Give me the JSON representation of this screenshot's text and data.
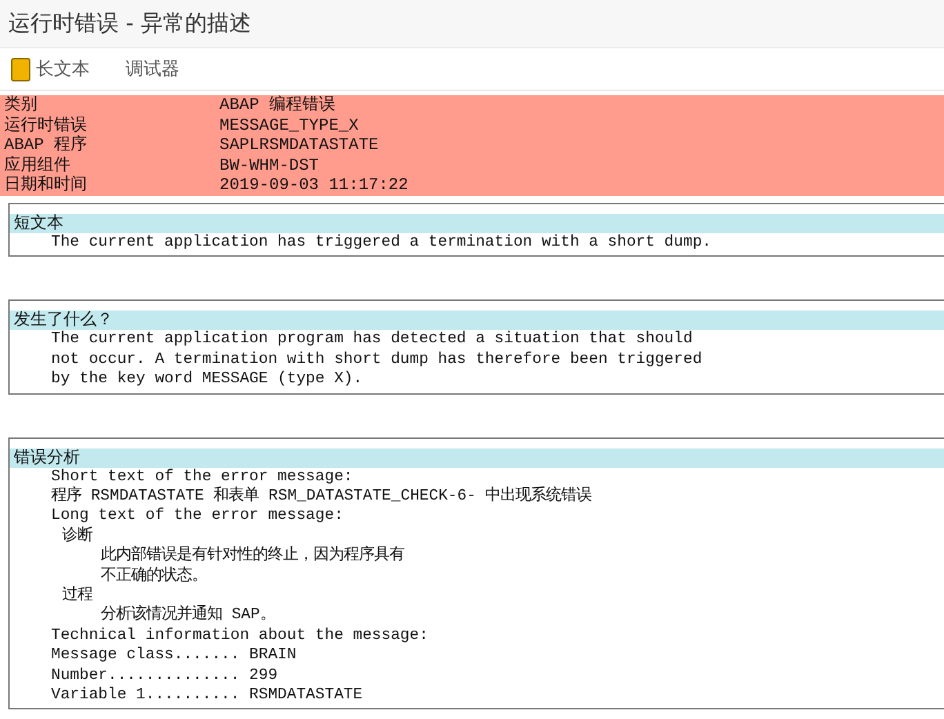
{
  "window": {
    "title": "运行时错误 - 异常的描述"
  },
  "toolbar": [
    {
      "label": "长文本",
      "icon": true
    },
    {
      "label": "调试器",
      "icon": false
    }
  ],
  "summary": [
    {
      "label": "类别",
      "value": "ABAP 编程错误"
    },
    {
      "label": "运行时错误",
      "value": "MESSAGE_TYPE_X"
    },
    {
      "label": "ABAP 程序",
      "value": "SAPLRSMDATASTATE"
    },
    {
      "label": "应用组件",
      "value": "BW-WHM-DST"
    },
    {
      "label": "日期和时间",
      "value": "2019-09-03 11:17:22"
    }
  ],
  "sections": [
    {
      "heading": "短文本",
      "lines": [
        {
          "kind": "line",
          "text": "The current application has triggered a termination with a short dump."
        }
      ]
    },
    {
      "heading": "发生了什么？",
      "lines": [
        {
          "kind": "line",
          "text": "The current application program has detected a situation that should"
        },
        {
          "kind": "line",
          "text": "not occur. A termination with short dump has therefore been triggered"
        },
        {
          "kind": "line",
          "text": "by the key word MESSAGE (type X)."
        }
      ]
    },
    {
      "heading": "错误分析",
      "lines": [
        {
          "kind": "line",
          "text": "Short text of the error message:"
        },
        {
          "kind": "line",
          "text": "程序 RSMDATASTATE 和表单 RSM_DATASTATE_CHECK-6- 中出现系统错误"
        },
        {
          "kind": "line",
          "text": "Long text of the error message:"
        },
        {
          "kind": "subhead",
          "text": "诊断"
        },
        {
          "kind": "detail",
          "text": "此内部错误是有针对性的终止，因为程序具有"
        },
        {
          "kind": "detail",
          "text": "不正确的状态。"
        },
        {
          "kind": "subhead",
          "text": "过程"
        },
        {
          "kind": "detail",
          "text": "分析该情况并通知 SAP。"
        },
        {
          "kind": "line",
          "text": "Technical information about the message:"
        },
        {
          "kind": "line",
          "text": "Message class....... BRAIN"
        },
        {
          "kind": "line",
          "text": "Number.............. 299"
        },
        {
          "kind": "line",
          "text": "Variable 1.......... RSMDATASTATE"
        }
      ]
    }
  ]
}
